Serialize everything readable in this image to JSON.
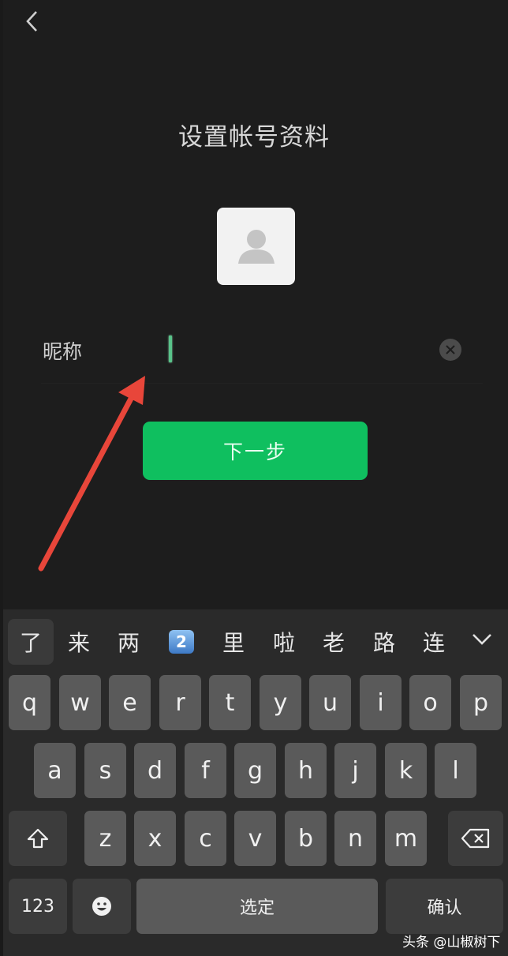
{
  "page": {
    "title": "设置帐号资料",
    "nickname_label": "昵称",
    "nickname_value": "",
    "next_button": "下一步"
  },
  "icons": {
    "back": "chevron-left-icon",
    "avatar": "default-user-icon",
    "clear": "close-icon",
    "collapse": "chevron-down-icon",
    "shift": "shift-icon",
    "backspace": "backspace-icon",
    "emoji": "emoji-icon"
  },
  "colors": {
    "background": "#1d1d1d",
    "accent_green": "#0fbf5f",
    "annotation_arrow": "#e8463a"
  },
  "keyboard": {
    "candidates": [
      "了",
      "来",
      "两",
      "2",
      "里",
      "啦",
      "老",
      "路",
      "连"
    ],
    "row1": [
      "q",
      "w",
      "e",
      "r",
      "t",
      "y",
      "u",
      "i",
      "o",
      "p"
    ],
    "row2": [
      "a",
      "s",
      "d",
      "f",
      "g",
      "h",
      "j",
      "k",
      "l"
    ],
    "row3": [
      "z",
      "x",
      "c",
      "v",
      "b",
      "n",
      "m"
    ],
    "numbers_key": "123",
    "space_key": "选定",
    "confirm_key": "确认"
  },
  "watermark": "头条 @山椒树下"
}
